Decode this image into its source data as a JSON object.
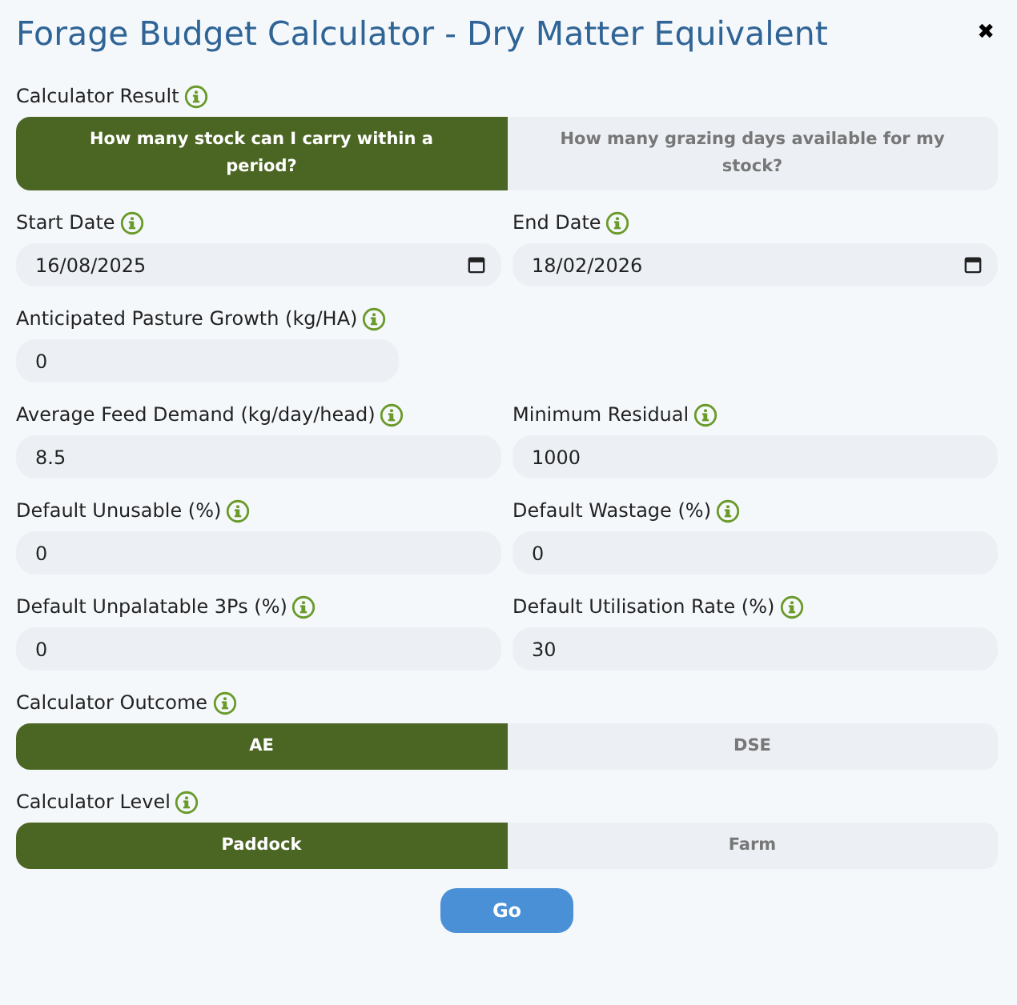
{
  "title": "Forage Budget Calculator - Dry Matter Equivalent",
  "close": "✖",
  "sections": [
    {
      "kind": "toggle",
      "label": "Calculator Result",
      "options": [
        {
          "label": "How many stock can I carry within a period?",
          "selected": true
        },
        {
          "label": "How many grazing days available for my stock?",
          "selected": false
        }
      ]
    },
    {
      "kind": "fields",
      "fields": [
        {
          "label": "Start Date",
          "value": "16/08/2025",
          "kind": "date"
        },
        {
          "label": "End Date",
          "value": "18/02/2026",
          "kind": "date"
        }
      ]
    },
    {
      "kind": "fields",
      "fields": [
        {
          "label": "Anticipated Pasture Growth (kg/HA)",
          "value": "0",
          "kind": "number"
        }
      ]
    },
    {
      "kind": "fields",
      "fields": [
        {
          "label": "Average Feed Demand (kg/day/head)",
          "value": "8.5",
          "kind": "number"
        },
        {
          "label": "Minimum Residual",
          "value": "1000",
          "kind": "number"
        }
      ]
    },
    {
      "kind": "fields",
      "fields": [
        {
          "label": "Default Unusable (%)",
          "value": "0",
          "kind": "number"
        },
        {
          "label": "Default Wastage (%)",
          "value": "0",
          "kind": "number"
        }
      ]
    },
    {
      "kind": "fields",
      "fields": [
        {
          "label": "Default Unpalatable 3Ps (%)",
          "value": "0",
          "kind": "number"
        },
        {
          "label": "Default Utilisation Rate (%)",
          "value": "30",
          "kind": "number"
        }
      ]
    },
    {
      "kind": "toggle",
      "label": "Calculator Outcome",
      "options": [
        {
          "label": "AE",
          "selected": true
        },
        {
          "label": "DSE",
          "selected": false
        }
      ]
    },
    {
      "kind": "toggle",
      "label": "Calculator Level",
      "options": [
        {
          "label": "Paddock",
          "selected": true
        },
        {
          "label": "Farm",
          "selected": false
        }
      ]
    }
  ],
  "go_button": "Go"
}
